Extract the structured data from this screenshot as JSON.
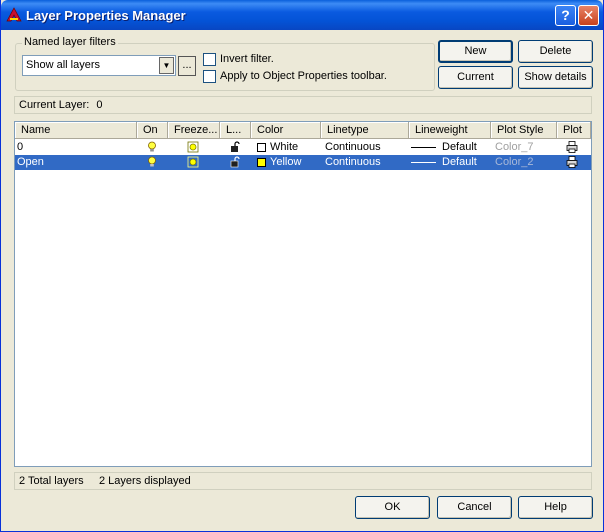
{
  "window": {
    "title": "Layer Properties Manager",
    "help_glyph": "?",
    "close_glyph": "✕"
  },
  "filters": {
    "legend": "Named layer filters",
    "selected": "Show all layers",
    "ellipsis": "...",
    "invert_label": "Invert filter.",
    "apply_label": "Apply to Object Properties toolbar."
  },
  "buttons": {
    "new": "New",
    "delete": "Delete",
    "current": "Current",
    "show_details": "Show details",
    "ok": "OK",
    "cancel": "Cancel",
    "help": "Help"
  },
  "current_layer": {
    "label": "Current Layer:",
    "value": "0"
  },
  "columns": [
    "Name",
    "On",
    "Freeze...",
    "L...",
    "Color",
    "Linetype",
    "Lineweight",
    "Plot Style",
    "Plot"
  ],
  "layers": [
    {
      "name": "0",
      "color_name": "White",
      "color_hex": "#ffffff",
      "linetype": "Continuous",
      "lineweight": "Default",
      "plot_style": "Color_7"
    },
    {
      "name": "Open",
      "color_name": "Yellow",
      "color_hex": "#ffff00",
      "linetype": "Continuous",
      "lineweight": "Default",
      "plot_style": "Color_2"
    }
  ],
  "status": {
    "total": "2 Total layers",
    "displayed": "2 Layers displayed"
  },
  "colors": {
    "selection": "#316ac5",
    "titlebar": "#0a5ae0"
  },
  "icons": {
    "on": "lightbulb-icon",
    "freeze": "sun-icon",
    "lock": "unlocked-padlock-icon",
    "plot": "printer-icon"
  }
}
